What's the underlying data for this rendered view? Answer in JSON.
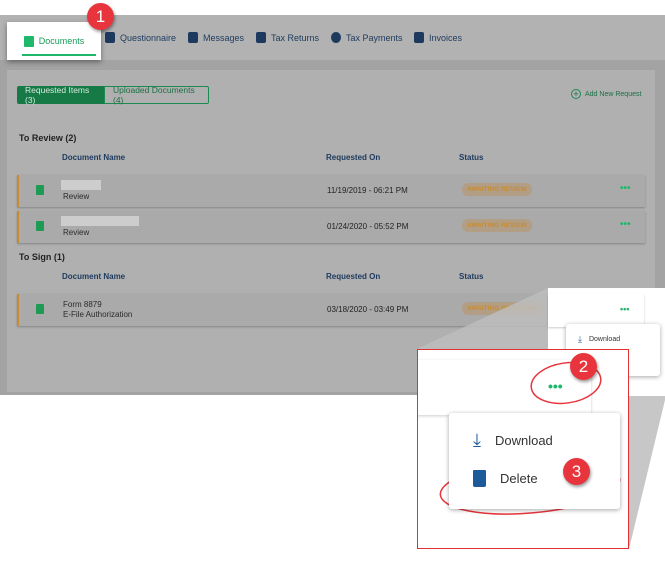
{
  "tabs": [
    {
      "label": "Documents",
      "icon": "documents-icon"
    },
    {
      "label": "Questionnaire",
      "icon": "clipboard-icon"
    },
    {
      "label": "Messages",
      "icon": "message-icon"
    },
    {
      "label": "Tax Returns",
      "icon": "tax-returns-icon"
    },
    {
      "label": "Tax Payments",
      "icon": "dollar-icon"
    },
    {
      "label": "Invoices",
      "icon": "invoice-icon"
    }
  ],
  "segments": {
    "requested": "Requested Items (3)",
    "uploaded": "Uploaded Documents (4)"
  },
  "add_request": "Add New Request",
  "headers": {
    "name": "Document Name",
    "requested": "Requested On",
    "status": "Status"
  },
  "to_review": {
    "title": "To Review",
    "count": "(2)",
    "rows": [
      {
        "subtitle": "Review",
        "date": "11/19/2019 - 06:21 PM",
        "status": "AWAITING REVIEW"
      },
      {
        "subtitle": "Review",
        "date": "01/24/2020 - 05:52 PM",
        "status": "AWAITING REVIEW"
      }
    ]
  },
  "to_sign": {
    "title": "To Sign",
    "count": "(1)",
    "rows": [
      {
        "name": "Form 8879",
        "subtitle": "E-File Authorization",
        "date": "03/18/2020 - 03:49 PM",
        "status": "AWAITING SIGNATURE"
      }
    ]
  },
  "menu": {
    "download": "Download",
    "delete": "Delete"
  },
  "more": "•••",
  "callouts": [
    "1",
    "2",
    "3"
  ],
  "colors": {
    "accent": "#1fb86a",
    "annotation": "#e8353d",
    "status": "#c98a2c"
  }
}
